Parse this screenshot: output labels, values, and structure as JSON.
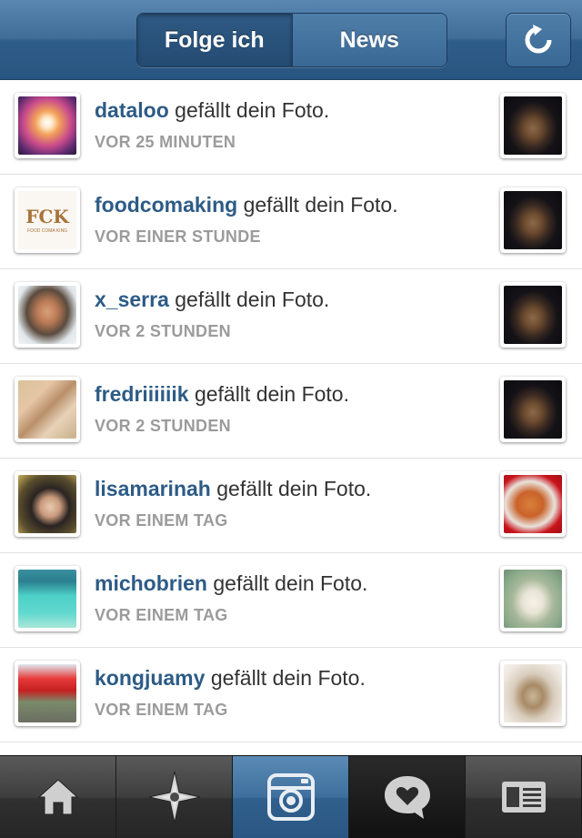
{
  "header": {
    "tab_following": "Folge ich",
    "tab_news": "News",
    "refresh_icon": "refresh-icon"
  },
  "feed": [
    {
      "username": "dataloo",
      "action": "gefällt dein Foto.",
      "time": "VOR 25 MINUTEN"
    },
    {
      "username": "foodcomaking",
      "action": "gefällt dein Foto.",
      "time": "VOR EINER STUNDE",
      "avatar_text": "FCK",
      "avatar_subtext": "FOOD COMA KING"
    },
    {
      "username": "x_serra",
      "action": "gefällt dein Foto.",
      "time": "VOR 2 STUNDEN"
    },
    {
      "username": "fredriiiiiik",
      "action": "gefällt dein Foto.",
      "time": "VOR 2 STUNDEN"
    },
    {
      "username": "lisamarinah",
      "action": "gefällt dein Foto.",
      "time": "VOR EINEM TAG"
    },
    {
      "username": "michobrien",
      "action": "gefällt dein Foto.",
      "time": "VOR EINEM TAG"
    },
    {
      "username": "kongjuamy",
      "action": "gefällt dein Foto.",
      "time": "VOR EINEM TAG"
    }
  ],
  "tabbar": {
    "items": [
      "home-icon",
      "explore-icon",
      "camera-icon",
      "news-icon",
      "profile-icon"
    ],
    "active": "camera-icon"
  },
  "colors": {
    "header_blue": "#3f6d98",
    "username_blue": "#2d5b86",
    "timestamp_gray": "#9b9b9b"
  }
}
